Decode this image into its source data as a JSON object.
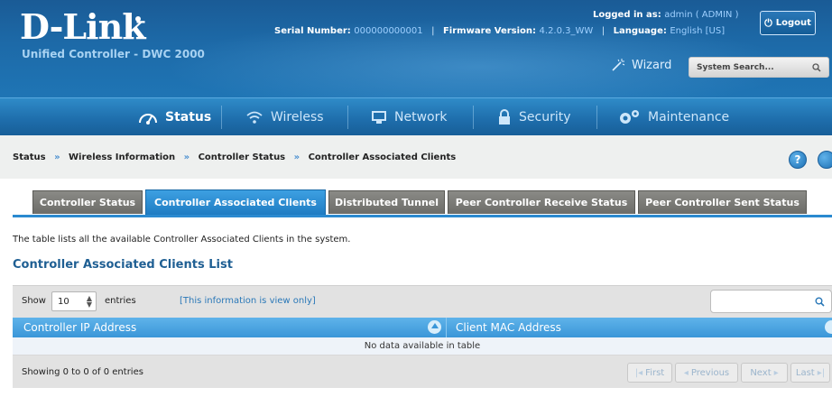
{
  "header": {
    "logo_text": "D-Link",
    "product_line": "Unified Controller - DWC 2000",
    "serial_label": "Serial Number:",
    "serial_value": "000000000001",
    "firmware_label": "Firmware Version:",
    "firmware_value": "4.2.0.3_WW",
    "language_label": "Language:",
    "language_value": "English [US]",
    "logged_label": "Logged in as:",
    "logged_value": "admin ( ADMIN )",
    "logout_label": "Logout",
    "wizard_label": "Wizard",
    "system_search_placeholder": "System Search..."
  },
  "nav": {
    "items": [
      {
        "label": "Status",
        "icon": "gauge-icon",
        "active": true
      },
      {
        "label": "Wireless",
        "icon": "wifi-icon",
        "active": false
      },
      {
        "label": "Network",
        "icon": "monitor-icon",
        "active": false
      },
      {
        "label": "Security",
        "icon": "lock-icon",
        "active": false
      },
      {
        "label": "Maintenance",
        "icon": "gears-icon",
        "active": false
      }
    ]
  },
  "breadcrumb": {
    "items": [
      "Status",
      "Wireless Information",
      "Controller Status",
      "Controller Associated Clients"
    ],
    "separator": "»"
  },
  "tabs": [
    {
      "label": "Controller Status",
      "active": false
    },
    {
      "label": "Controller Associated Clients",
      "active": true
    },
    {
      "label": "Distributed Tunnel",
      "active": false
    },
    {
      "label": "Peer Controller Receive Status",
      "active": false
    },
    {
      "label": "Peer Controller Sent Status",
      "active": false
    }
  ],
  "content": {
    "description": "The table lists all the available Controller Associated Clients in the system.",
    "list_title": "Controller Associated Clients List",
    "show_label": "Show",
    "entries_value": "10",
    "entries_label": "entries",
    "view_only_note": "[This information is view only]",
    "columns": [
      "Controller IP Address",
      "Client MAC Address"
    ],
    "empty_message": "No data available in table",
    "showing_text": "Showing 0 to 0 of 0 entries",
    "pagination": {
      "first": "First",
      "previous": "Previous",
      "next": "Next",
      "last": "Last"
    }
  },
  "colors": {
    "header_blue": "#1d6aa8",
    "tab_active": "#2b8ad0",
    "tab_inactive": "#7a7a76",
    "table_header": "#4aa2e0"
  }
}
